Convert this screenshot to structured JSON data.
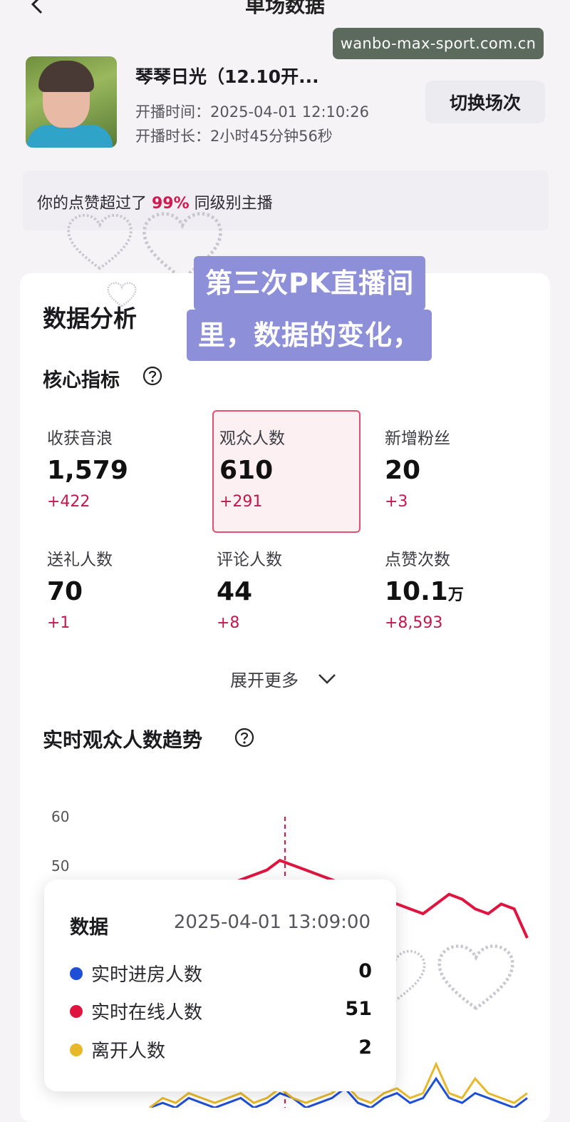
{
  "header": {
    "title": "单场数据"
  },
  "watermark": "wanbo-max-sport.com.cn",
  "session": {
    "streamer_name": "琴琴日光（12.10开...",
    "start_time_label": "开播时间：",
    "start_time": "2025-04-01 12:10:26",
    "duration_label": "开播时长：",
    "duration": "2小时45分钟56秒",
    "switch_button": "切换场次"
  },
  "like_banner": {
    "prefix": "你的点赞超过了 ",
    "percent": "99%",
    "suffix": " 同级别主播"
  },
  "overlay_caption": {
    "line1": "第三次PK直播间",
    "line2": "里，数据的变化，"
  },
  "analysis": {
    "title": "数据分析",
    "core_title": "核心指标",
    "metrics": [
      {
        "label": "收获音浪",
        "value": "1,579",
        "unit": "",
        "delta": "+422"
      },
      {
        "label": "观众人数",
        "value": "610",
        "unit": "",
        "delta": "+291"
      },
      {
        "label": "新增粉丝",
        "value": "20",
        "unit": "",
        "delta": "+3"
      },
      {
        "label": "送礼人数",
        "value": "70",
        "unit": "",
        "delta": "+1"
      },
      {
        "label": "评论人数",
        "value": "44",
        "unit": "",
        "delta": "+8"
      },
      {
        "label": "点赞次数",
        "value": "10.1",
        "unit": "万",
        "delta": "+8,593"
      }
    ],
    "expand_label": "展开更多",
    "trend_title": "实时观众人数趋势"
  },
  "chart_data": {
    "type": "line",
    "title": "实时观众人数趋势",
    "y_ticks": [
      "60",
      "50"
    ],
    "ylim": [
      0,
      60
    ],
    "series": [
      {
        "name": "实时进房人数",
        "color": "#1e4fd6",
        "values": [
          0,
          1,
          0,
          2,
          1,
          0,
          1,
          2,
          0,
          1,
          3,
          2,
          0,
          1,
          2,
          4,
          1,
          0,
          2,
          3,
          1,
          2,
          6,
          2,
          1,
          3,
          2,
          1,
          0,
          2
        ]
      },
      {
        "name": "实时在线人数",
        "color": "#e0153f",
        "values": [
          40,
          41,
          42,
          43,
          44,
          45,
          46,
          47,
          48,
          49,
          51,
          50,
          49,
          48,
          47,
          46,
          45,
          44,
          43,
          42,
          41,
          40,
          42,
          44,
          43,
          41,
          40,
          42,
          41,
          35
        ]
      },
      {
        "name": "离开人数",
        "color": "#e7b82a",
        "values": [
          0,
          2,
          1,
          3,
          2,
          1,
          2,
          3,
          1,
          2,
          4,
          2,
          1,
          2,
          3,
          5,
          2,
          1,
          3,
          4,
          2,
          3,
          9,
          3,
          2,
          6,
          3,
          2,
          1,
          3
        ]
      }
    ],
    "tooltip": {
      "title": "数据",
      "time": "2025-04-01 13:09:00",
      "rows": [
        {
          "name": "实时进房人数",
          "value": "0",
          "color": "#1e4fd6"
        },
        {
          "name": "实时在线人数",
          "value": "51",
          "color": "#e0153f"
        },
        {
          "name": "离开人数",
          "value": "2",
          "color": "#e7b82a"
        }
      ]
    }
  }
}
